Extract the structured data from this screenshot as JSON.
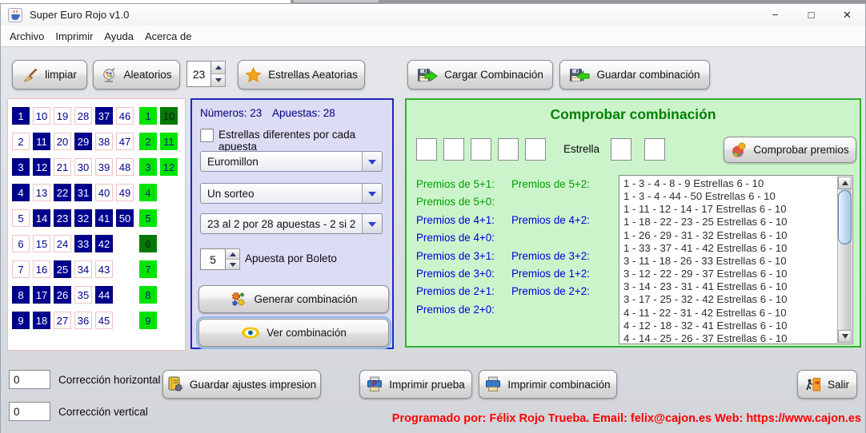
{
  "window": {
    "title": "Super Euro Rojo v1.0",
    "minimize": "−",
    "maximize": "□",
    "close": "✕"
  },
  "menu": {
    "items": [
      "Archivo",
      "Imprimir",
      "Ayuda",
      "Acerca de"
    ]
  },
  "toolbar": {
    "limpiar_label": "limpiar",
    "aleatorios_label": "Aleatorios",
    "numbers_spinner_value": "23",
    "estrellas_label": "Estrellas Aeatorias",
    "cargar_label": "Cargar Combinación",
    "guardar_label": "Guardar combinación"
  },
  "number_grid": {
    "columns": [
      [
        1,
        2,
        3,
        4,
        5,
        6,
        7,
        8,
        9
      ],
      [
        10,
        11,
        12,
        13,
        14,
        15,
        16,
        17,
        18
      ],
      [
        19,
        20,
        21,
        22,
        23,
        24,
        25,
        26,
        27
      ],
      [
        28,
        29,
        30,
        31,
        32,
        33,
        34,
        35,
        36
      ],
      [
        37,
        38,
        39,
        40,
        41,
        42,
        43,
        44,
        45
      ],
      [
        46,
        47,
        48,
        49,
        50
      ]
    ],
    "selected": [
      1,
      3,
      4,
      8,
      9,
      11,
      12,
      14,
      17,
      18,
      22,
      23,
      25,
      26,
      29,
      31,
      32,
      33,
      37,
      41,
      42,
      44,
      50
    ],
    "star_columns": [
      [
        1,
        2,
        3,
        4,
        5,
        6,
        7,
        8,
        9
      ],
      [
        10,
        11,
        12
      ]
    ],
    "star_selected": [
      6,
      10
    ]
  },
  "options": {
    "numeros_label": "Números: 23",
    "apuestas_label": "Apuestas: 28",
    "estrellas_checkbox_label": "Estrellas diferentes por cada apuesta",
    "checkbox_checked": false,
    "game_select": "Euromillon",
    "draw_select": "Un sorteo",
    "reduction_select": "23 al 2 por 28 apuestas - 2 si 2",
    "apuesta_spinner_value": "5",
    "apuesta_spinner_label": "Apuesta por Boleto",
    "generar_label": "Generar combinación",
    "ver_label": "Ver combinación"
  },
  "check": {
    "title": "Comprobar combinación",
    "estrella_label": "Estrella",
    "comprobar_label": "Comprobar premios",
    "prize_rows": [
      {
        "left": "Premios de 5+1:",
        "right": "Premios de 5+2:",
        "color": "green"
      },
      {
        "left": "Premios de 5+0:",
        "right": "",
        "color": "green"
      },
      {
        "left": "Premios de 4+1:",
        "right": "Premios de 4+2:",
        "color": "blue"
      },
      {
        "left": "Premios de 4+0:",
        "right": "",
        "color": "blue"
      },
      {
        "left": "Premios de 3+1:",
        "right": "Premios de 3+2:",
        "color": "blue"
      },
      {
        "left": "Premios de 3+0:",
        "right": "Premios de 1+2:",
        "color": "blue"
      },
      {
        "left": "Premios de 2+1:",
        "right": "Premios de 2+2:",
        "color": "blue"
      },
      {
        "left": "Premios de 2+0:",
        "right": "",
        "color": "blue"
      }
    ],
    "combinations": [
      "1 - 3 - 4 - 8 - 9 Estrellas 6 - 10",
      "1 - 3 - 4 - 44 - 50 Estrellas 6 - 10",
      "1 - 11 - 12 - 14 - 17 Estrellas 6 - 10",
      "1 - 18 - 22 - 23 - 25 Estrellas 6 - 10",
      "1 - 26 - 29 - 31 - 32 Estrellas 6 - 10",
      "1 - 33 - 37 - 41 - 42 Estrellas 6 - 10",
      "3 - 11 - 18 - 26 - 33 Estrellas 6 - 10",
      "3 - 12 - 22 - 29 - 37 Estrellas 6 - 10",
      "3 - 14 - 23 - 31 - 41 Estrellas 6 - 10",
      "3 - 17 - 25 - 32 - 42 Estrellas 6 - 10",
      "4 - 11 - 22 - 31 - 42 Estrellas 6 - 10",
      "4 - 12 - 18 - 32 - 41 Estrellas 6 - 10",
      "4 - 14 - 25 - 26 - 37 Estrellas 6 - 10"
    ]
  },
  "bottom": {
    "h_correction_value": "0",
    "h_correction_label": "Corrección horizontal",
    "v_correction_value": "0",
    "v_correction_label": "Corrección vertical",
    "guardar_ajustes_label": "Guardar ajustes impresion",
    "imprimir_prueba_label": "Imprimir prueba",
    "imprimir_combinacion_label": "Imprimir combinación",
    "salir_label": "Salir",
    "credit": "Programado por: Félix Rojo Trueba. Email: felix@cajon.es Web: https://www.cajon.es"
  },
  "colors": {
    "selected_number_bg": "#00008f",
    "star_bright_bg": "#00e400",
    "star_selected_bg": "#077807",
    "options_panel_bg": "#dcdcf4",
    "options_panel_border": "#2424c8",
    "check_panel_bg": "#ccf4cb",
    "check_panel_border": "#2cb42c",
    "prize_green": "#00a000",
    "prize_blue": "#0000dd",
    "credit_red": "#ff0000"
  }
}
